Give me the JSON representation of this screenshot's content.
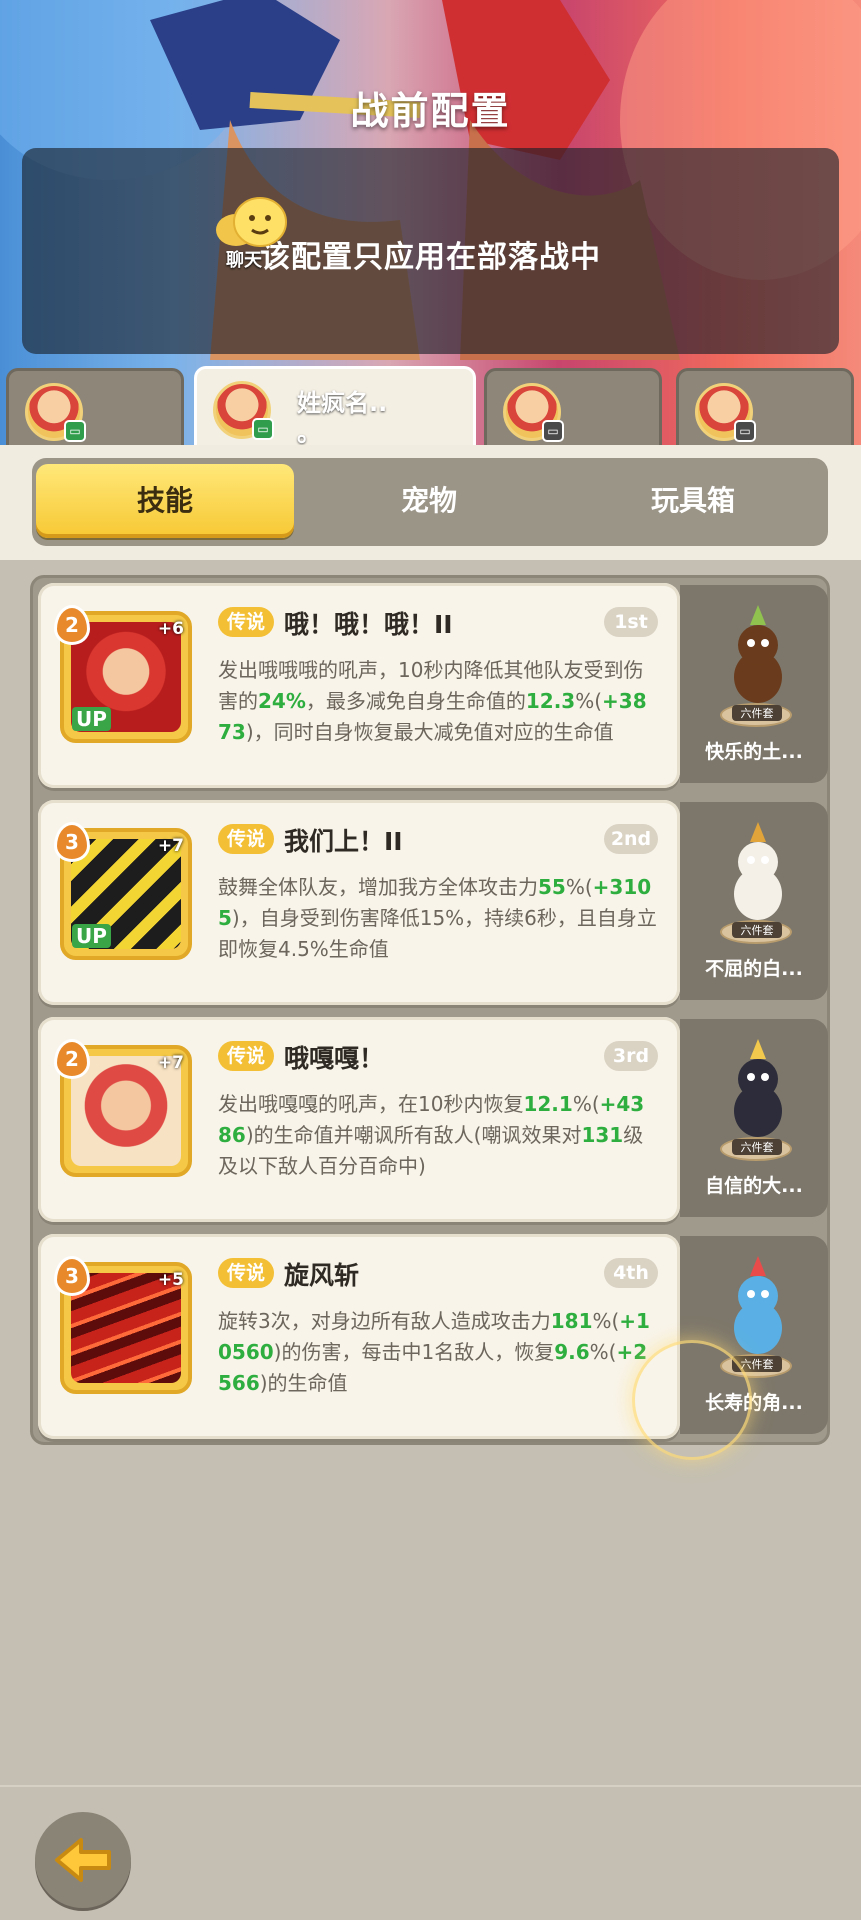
{
  "header": {
    "title": "战前配置",
    "notice": "该配置只应用在部落战中",
    "chat_label": "聊天"
  },
  "characters": [
    {
      "name": "",
      "status": "chat-green"
    },
    {
      "name_line1": "姓疯名..",
      "name_line2": "。",
      "status": "chat-green"
    },
    {
      "name": "",
      "status": "chat-grey"
    },
    {
      "name": "",
      "status": "chat-grey"
    }
  ],
  "tabs": [
    "技能",
    "宠物",
    "玩具箱"
  ],
  "skills": [
    {
      "level": "2",
      "plus": "+6",
      "up": "UP",
      "tier": "传说",
      "name": "哦！哦！哦！II",
      "rank": "1st",
      "desc": [
        {
          "t": "发出哦哦哦的吼声，10秒内降低其他队友受到伤害的"
        },
        {
          "t": "24%",
          "g": true
        },
        {
          "t": "，最多减免自身生命值的"
        },
        {
          "t": "12.3",
          "g": true
        },
        {
          "t": "%("
        },
        {
          "t": "+3873",
          "g": true
        },
        {
          "t": ")，同时自身恢复最大减免值对应的生命值"
        }
      ],
      "pet": {
        "name": "快乐的土...",
        "tag": "六件套"
      }
    },
    {
      "level": "3",
      "plus": "+7",
      "up": "UP",
      "tier": "传说",
      "name": "我们上！II",
      "rank": "2nd",
      "desc": [
        {
          "t": "鼓舞全体队友，增加我方全体攻击力"
        },
        {
          "t": "55",
          "g": true
        },
        {
          "t": "%("
        },
        {
          "t": "+3105",
          "g": true
        },
        {
          "t": ")，自身受到伤害降低15%，持续6秒，且自身立即恢复4.5%生命值"
        }
      ],
      "pet": {
        "name": "不屈的白...",
        "tag": "六件套"
      }
    },
    {
      "level": "2",
      "plus": "+7",
      "up": "",
      "tier": "传说",
      "name": "哦嘎嘎！",
      "rank": "3rd",
      "desc": [
        {
          "t": "发出哦嘎嘎的吼声，在10秒内恢复"
        },
        {
          "t": "12.1",
          "g": true
        },
        {
          "t": "%("
        },
        {
          "t": "+4386",
          "g": true
        },
        {
          "t": ")的生命值并嘲讽所有敌人(嘲讽效果对"
        },
        {
          "t": "131",
          "g": true
        },
        {
          "t": "级及以下敌人百分百命中)"
        }
      ],
      "pet": {
        "name": "自信的大...",
        "tag": "六件套"
      }
    },
    {
      "level": "3",
      "plus": "+5",
      "up": "",
      "tier": "传说",
      "name": "旋风斩",
      "rank": "4th",
      "desc": [
        {
          "t": "旋转3次，对身边所有敌人造成攻击力"
        },
        {
          "t": "181",
          "g": true
        },
        {
          "t": "%("
        },
        {
          "t": "+10560",
          "g": true
        },
        {
          "t": ")的伤害，每击中1名敌人，恢复"
        },
        {
          "t": "9.6",
          "g": true
        },
        {
          "t": "%("
        },
        {
          "t": "+2566",
          "g": true
        },
        {
          "t": ")的生命值"
        }
      ],
      "pet": {
        "name": "长寿的角...",
        "tag": "六件套"
      }
    }
  ],
  "colors": {
    "accent_yellow": "#f7c833",
    "green_value": "#2eae3e",
    "panel_bg": "#c4bfb2"
  }
}
